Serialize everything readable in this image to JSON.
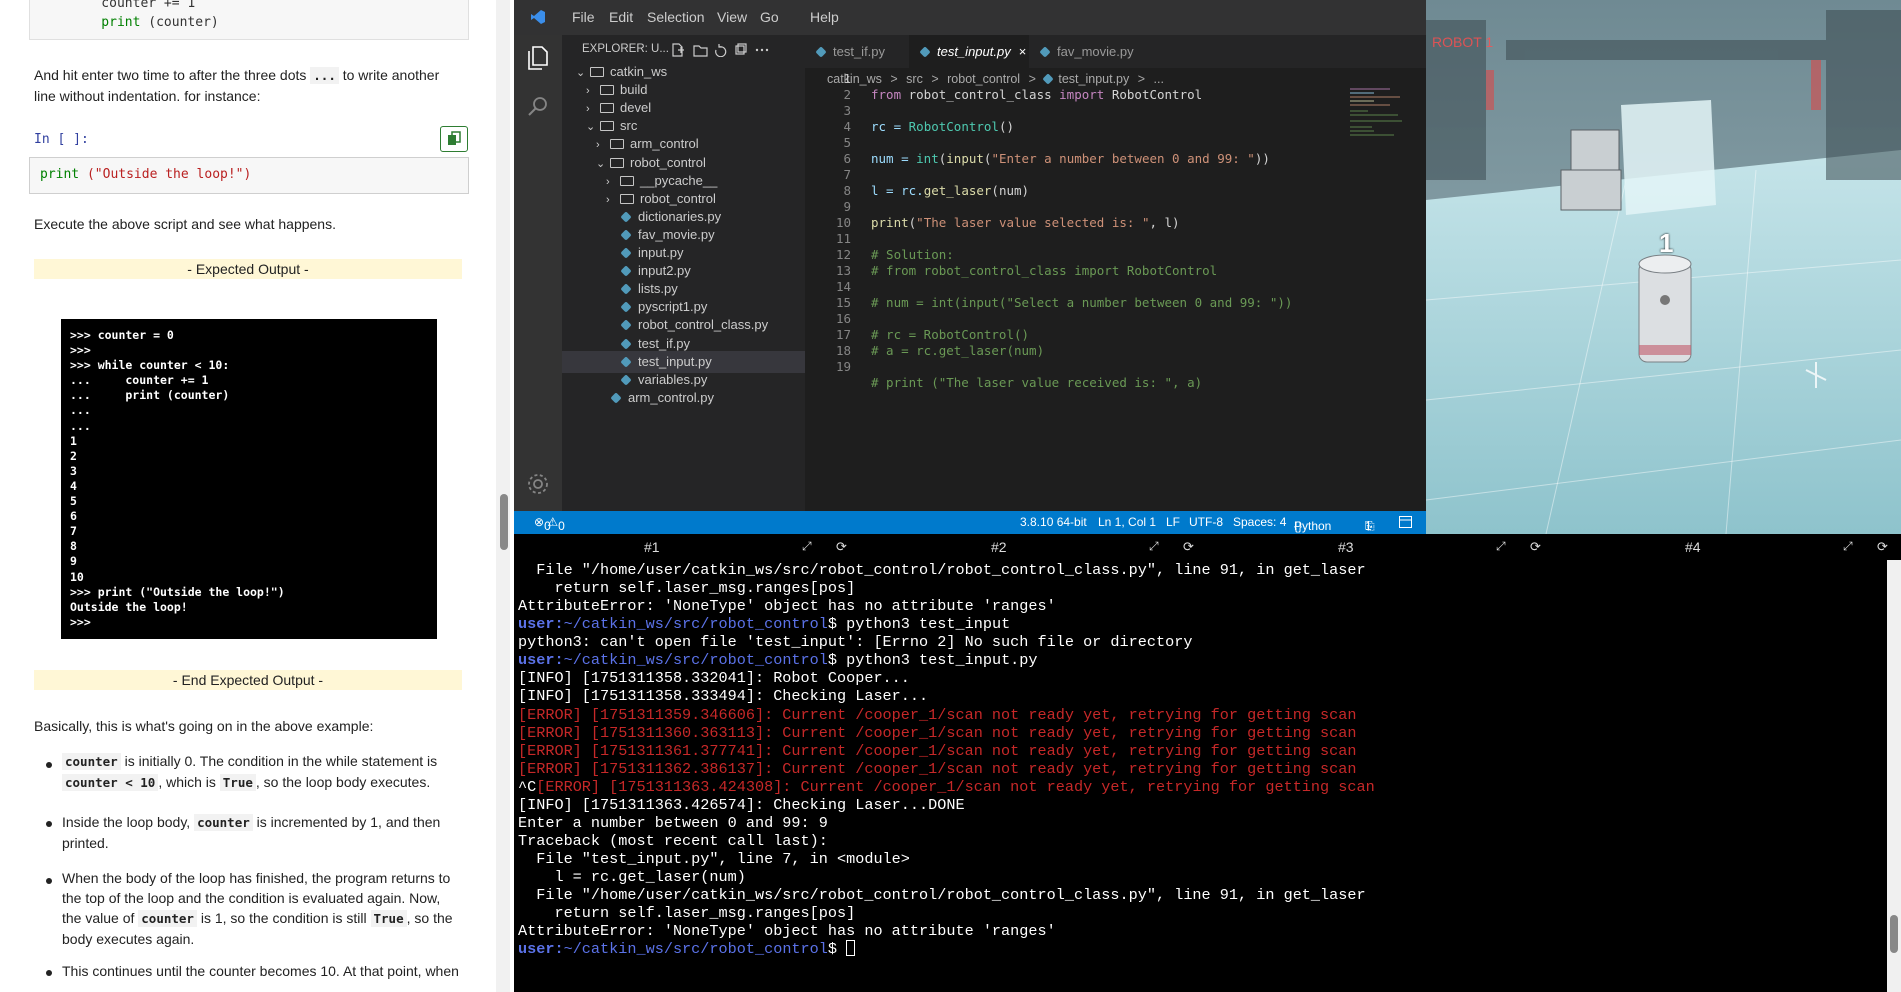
{
  "notebook": {
    "top_code": [
      "    counter += 1",
      "    print (counter)"
    ],
    "para1": [
      "And hit enter two time to after the three dots",
      "...",
      "to write another",
      "line without indentation. for instance:"
    ],
    "in_label": "In [ ]:",
    "cell_code_fn": "print",
    "cell_code_str": " (\"Outside the loop!\")",
    "para2": "Execute the above script and see what happens.",
    "expected_band": "- Expected Output -",
    "terminal_lines": [
      ">>> counter = 0",
      ">>>",
      ">>> while counter < 10:",
      "...     counter += 1",
      "...     print (counter)",
      "...",
      "...",
      "1",
      "2",
      "3",
      "4",
      "5",
      "6",
      "7",
      "8",
      "9",
      "10",
      ">>> print (\"Outside the loop!\")",
      "Outside the loop!",
      ">>>"
    ],
    "end_band": "- End Expected Output -",
    "para3": "Basically, this is what's going on in the above example:",
    "bullets": {
      "b1": [
        "counter",
        "is initially 0. The condition in the while statement is",
        "counter < 10",
        ", which is",
        "True",
        ", so the loop body executes."
      ],
      "b2": [
        "Inside the loop body,",
        "counter",
        "is incremented by 1, and then",
        "printed."
      ],
      "b3": [
        "When the body of the loop has finished, the program returns to",
        "the top of the loop and the condition is evaluated again. Now,",
        "the value of",
        "counter",
        "is 1, so the condition is still",
        "True",
        ", so the",
        "body executes again."
      ],
      "b4": "This continues until the counter becomes 10. At that point, when"
    }
  },
  "vscode": {
    "menu": [
      "File",
      "Edit",
      "Selection",
      "View",
      "Go",
      "Help"
    ],
    "explorer_title": "EXPLORER: U...",
    "tree": [
      {
        "label": "catkin_ws",
        "type": "folder",
        "open": true,
        "depth": 0
      },
      {
        "label": "build",
        "type": "folder",
        "open": false,
        "depth": 1
      },
      {
        "label": "devel",
        "type": "folder",
        "open": false,
        "depth": 1
      },
      {
        "label": "src",
        "type": "folder",
        "open": true,
        "depth": 1
      },
      {
        "label": "arm_control",
        "type": "folder",
        "open": false,
        "depth": 2
      },
      {
        "label": "robot_control",
        "type": "folder",
        "open": true,
        "depth": 2
      },
      {
        "label": "__pycache__",
        "type": "folder",
        "open": false,
        "depth": 3
      },
      {
        "label": "robot_control",
        "type": "folder",
        "open": false,
        "depth": 3
      },
      {
        "label": "dictionaries.py",
        "type": "file",
        "depth": 3
      },
      {
        "label": "fav_movie.py",
        "type": "file",
        "depth": 3
      },
      {
        "label": "input.py",
        "type": "file",
        "depth": 3
      },
      {
        "label": "input2.py",
        "type": "file",
        "depth": 3
      },
      {
        "label": "lists.py",
        "type": "file",
        "depth": 3
      },
      {
        "label": "pyscript1.py",
        "type": "file",
        "depth": 3
      },
      {
        "label": "robot_control_class.py",
        "type": "file",
        "depth": 3
      },
      {
        "label": "test_if.py",
        "type": "file",
        "depth": 3
      },
      {
        "label": "test_input.py",
        "type": "file",
        "depth": 3,
        "selected": true
      },
      {
        "label": "variables.py",
        "type": "file",
        "depth": 3
      },
      {
        "label": "arm_control.py",
        "type": "file",
        "depth": 2
      }
    ],
    "tabs": [
      "test_if.py",
      "test_input.py",
      "fav_movie.py"
    ],
    "close_glyph": "×",
    "breadcrumb": [
      "catkin_ws",
      ">",
      "src",
      ">",
      "robot_control",
      ">",
      "test_input.py",
      ">",
      "..."
    ],
    "line_numbers": [
      "1",
      "2",
      "3",
      "4",
      "5",
      "6",
      "7",
      "8",
      "9",
      "10",
      "11",
      "12",
      "13",
      "14",
      "15",
      "16",
      "17",
      "18",
      "19"
    ],
    "code": {
      "l1": [
        "from",
        " robot_control_class ",
        "import",
        " RobotControl"
      ],
      "l3": [
        "rc = ",
        "RobotControl",
        "()"
      ],
      "l5": [
        "num = ",
        "int",
        "(",
        "input",
        "(",
        "\"Enter a number between 0 and 99: \"",
        "))"
      ],
      "l7": [
        "l = rc.",
        "get_laser",
        "(num)"
      ],
      "l9": [
        "print",
        "(",
        "\"The laser value selected is: \"",
        ", l)"
      ],
      "l11": "# Solution:",
      "l12": "# from robot_control_class import RobotControl",
      "l14": "# num = int(input(\"Select a number between 0 and 99: \"))",
      "l16": "# rc = RobotControl()",
      "l17": "# a = rc.get_laser(num)",
      "l19": "# print (\"The laser value received is: \", a)"
    },
    "status": {
      "errors": "0",
      "warnings": "0",
      "python_ver": "3.8.10 64-bit",
      "position": "Ln 1, Col 1",
      "eol": "LF",
      "encoding": "UTF-8",
      "spaces": "Spaces: 4",
      "lang": "Python",
      "ports": "1"
    }
  },
  "sim": {
    "robot_label": "ROBOT 1",
    "marker": "1"
  },
  "terminal_tabs": [
    "#1",
    "#2",
    "#3",
    "#4"
  ],
  "terminal": {
    "lines": [
      {
        "t": "  File \"/home/user/catkin_ws/src/robot_control/robot_control_class.py\", line 91, in get_laser",
        "k": "n"
      },
      {
        "t": "    return self.laser_msg.ranges[pos]",
        "k": "n"
      },
      {
        "t": "AttributeError: 'NoneType' object has no attribute 'ranges'",
        "k": "n"
      },
      {
        "t": "python3 test_input",
        "k": "p"
      },
      {
        "t": "python3: can't open file 'test_input': [Errno 2] No such file or directory",
        "k": "n"
      },
      {
        "t": "python3 test_input.py",
        "k": "p"
      },
      {
        "t": "[INFO] [1751311358.332041]: Robot Cooper...",
        "k": "n"
      },
      {
        "t": "[INFO] [1751311358.333494]: Checking Laser...",
        "k": "n"
      },
      {
        "t": "[ERROR] [1751311359.346606]: Current /cooper_1/scan not ready yet, retrying for getting scan",
        "k": "e"
      },
      {
        "t": "[ERROR] [1751311360.363113]: Current /cooper_1/scan not ready yet, retrying for getting scan",
        "k": "e"
      },
      {
        "t": "[ERROR] [1751311361.377741]: Current /cooper_1/scan not ready yet, retrying for getting scan",
        "k": "e"
      },
      {
        "t": "[ERROR] [1751311362.386137]: Current /cooper_1/scan not ready yet, retrying for getting scan",
        "k": "e"
      },
      {
        "t": "[ERROR] [1751311363.424308]: Current /cooper_1/scan not ready yet, retrying for getting scan",
        "k": "ce",
        "pre": "^C"
      },
      {
        "t": "[INFO] [1751311363.426574]: Checking Laser...DONE",
        "k": "n"
      },
      {
        "t": "Enter a number between 0 and 99: 9",
        "k": "n"
      },
      {
        "t": "Traceback (most recent call last):",
        "k": "n"
      },
      {
        "t": "  File \"test_input.py\", line 7, in <module>",
        "k": "n"
      },
      {
        "t": "    l = rc.get_laser(num)",
        "k": "n"
      },
      {
        "t": "  File \"/home/user/catkin_ws/src/robot_control/robot_control_class.py\", line 91, in get_laser",
        "k": "n"
      },
      {
        "t": "    return self.laser_msg.ranges[pos]",
        "k": "n"
      },
      {
        "t": "AttributeError: 'NoneType' object has no attribute 'ranges'",
        "k": "n"
      },
      {
        "t": "",
        "k": "p"
      }
    ],
    "prompt_user": "user:",
    "prompt_path": "~/catkin_ws/src/robot_control",
    "prompt_end": "$ "
  }
}
